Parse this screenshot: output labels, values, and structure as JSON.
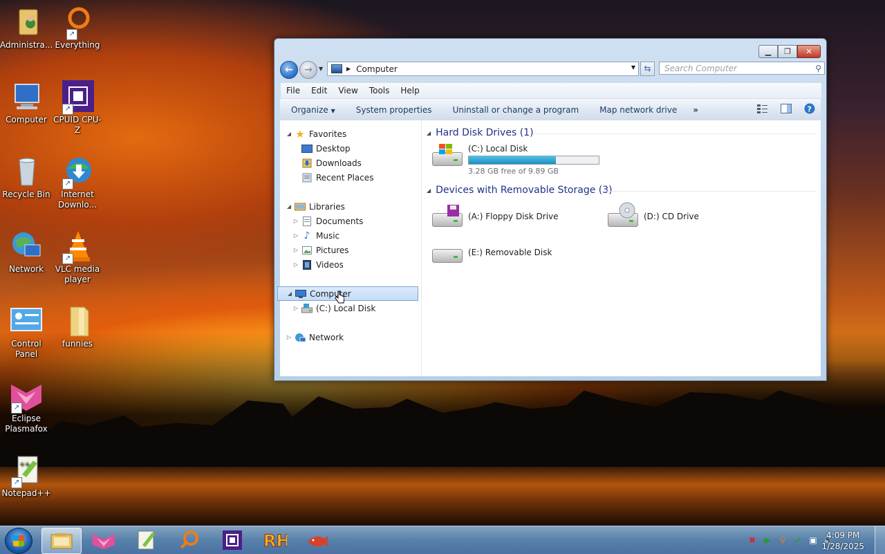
{
  "desktop": {
    "icons": [
      {
        "label": "Administra...",
        "icon": "user-folder-icon"
      },
      {
        "label": "Everything",
        "icon": "everything-search-icon"
      },
      {
        "label": "Computer",
        "icon": "computer-icon"
      },
      {
        "label": "CPUID CPU-Z",
        "icon": "cpu-z-icon"
      },
      {
        "label": "Recycle Bin",
        "icon": "recycle-bin-icon"
      },
      {
        "label": "Internet Downlo...",
        "icon": "internet-download-manager-icon"
      },
      {
        "label": "Network",
        "icon": "network-icon"
      },
      {
        "label": "VLC media player",
        "icon": "vlc-icon"
      },
      {
        "label": "Control Panel",
        "icon": "control-panel-icon"
      },
      {
        "label": "funnies",
        "icon": "folder-icon"
      },
      {
        "label": "Eclipse Plasmafox",
        "icon": "plasmafox-icon"
      },
      {
        "label": "Notepad++",
        "icon": "notepad-plus-plus-icon"
      }
    ]
  },
  "window": {
    "address": "Computer",
    "search_placeholder": "Search Computer",
    "menu": [
      "File",
      "Edit",
      "View",
      "Tools",
      "Help"
    ],
    "toolbar": {
      "organize": "Organize",
      "system_properties": "System properties",
      "uninstall": "Uninstall or change a program",
      "map_drive": "Map network drive",
      "more": "»"
    },
    "nav": {
      "favorites": "Favorites",
      "desktop": "Desktop",
      "downloads": "Downloads",
      "recent": "Recent Places",
      "libraries": "Libraries",
      "documents": "Documents",
      "music": "Music",
      "pictures": "Pictures",
      "videos": "Videos",
      "computer": "Computer",
      "local_disk": "(C:) Local Disk",
      "network": "Network"
    },
    "groups": {
      "hdd": "Hard Disk Drives (1)",
      "removable": "Devices with Removable Storage (3)"
    },
    "drives": {
      "c": {
        "name": "(C:) Local Disk",
        "free": "3.28 GB free of 9.89 GB",
        "used_fraction": 0.668
      },
      "a": {
        "name": "(A:) Floppy Disk Drive"
      },
      "d": {
        "name": "(D:) CD Drive"
      },
      "e": {
        "name": "(E:) Removable Disk"
      }
    }
  },
  "taskbar": {
    "time": "4:09 PM",
    "date": "1/28/2025",
    "pinned": [
      "explorer-icon",
      "plasmafox-icon",
      "notepad-plus-plus-icon",
      "everything-icon",
      "cpu-z-icon",
      "rh-icon",
      "redfish-icon"
    ]
  },
  "colors": {
    "group_header": "#1e3287",
    "progress": "#1d8fbc",
    "selection": "#c4dcf8"
  }
}
